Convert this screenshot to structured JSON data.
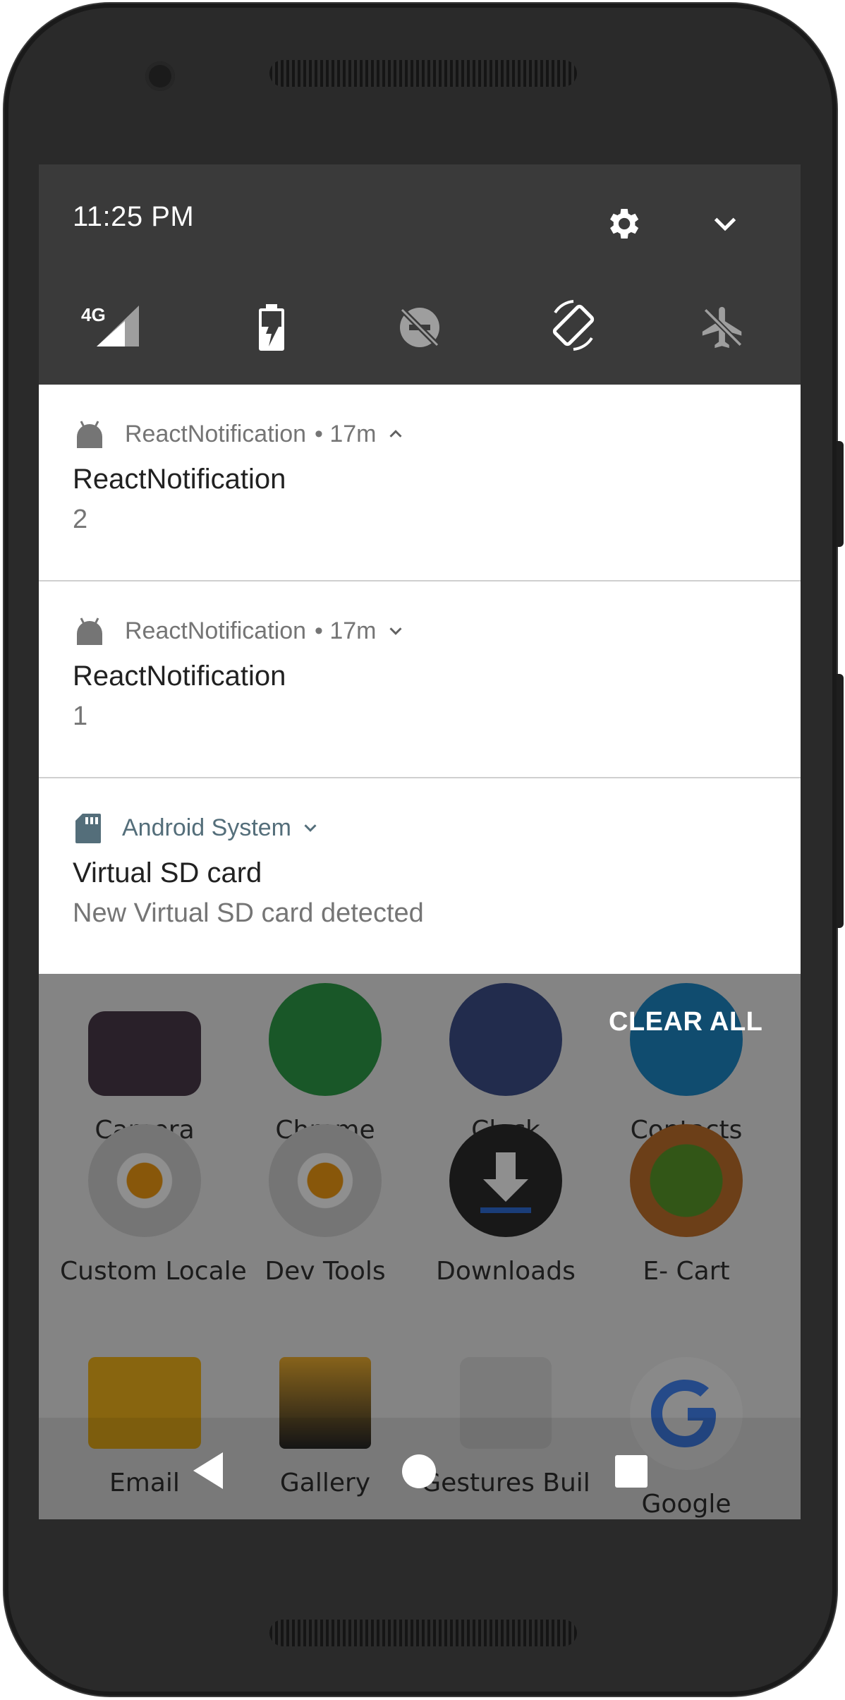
{
  "status": {
    "time": "11:25 PM"
  },
  "quick_settings": {
    "signal_label": "4G",
    "icons": [
      "settings-icon",
      "expand-chevron-icon",
      "cellular-signal-icon",
      "battery-saver-icon",
      "do-not-disturb-icon",
      "auto-rotate-icon",
      "airplane-mode-icon"
    ]
  },
  "notifications": [
    {
      "app": "ReactNotification",
      "meta": "• 17m",
      "expander": "chevron-up-icon",
      "title": "ReactNotification",
      "text": "2"
    },
    {
      "app": "ReactNotification",
      "meta": "• 17m",
      "expander": "chevron-down-icon",
      "title": "ReactNotification",
      "text": "1"
    },
    {
      "app": "Android System",
      "meta": "",
      "expander": "chevron-down-icon",
      "title": "Virtual SD card",
      "text": "New Virtual SD card detected"
    }
  ],
  "clear_all_label": "CLEAR ALL",
  "launcher": {
    "apps": [
      {
        "label": "Camera",
        "color": "#555555"
      },
      {
        "label": "Chrome",
        "color": "#2e9b48"
      },
      {
        "label": "Clock",
        "color": "#3d4f8a"
      },
      {
        "label": "Contacts",
        "color": "#1e88c7"
      },
      {
        "label": "Custom Locale",
        "color": "#c8c8c8"
      },
      {
        "label": "Dev Tools",
        "color": "#c8c8c8"
      },
      {
        "label": "Downloads",
        "color": "#2b2b2b"
      },
      {
        "label": "E- Cart",
        "color": "#b9692a"
      },
      {
        "label": "Email",
        "color": "#f2b41c"
      },
      {
        "label": "Gallery",
        "color": "#2a2a2a"
      },
      {
        "label": "Gestures Buil",
        "color": "#dcdcdc"
      },
      {
        "label": "Google",
        "color": "#f4f4f4"
      }
    ]
  },
  "nav": {
    "icons": [
      "back-icon",
      "home-icon",
      "recents-icon"
    ]
  },
  "colors": {
    "qs_bg": "#3a3a3a",
    "android_system_accent": "#546e7a",
    "notif_meta": "#757575"
  }
}
